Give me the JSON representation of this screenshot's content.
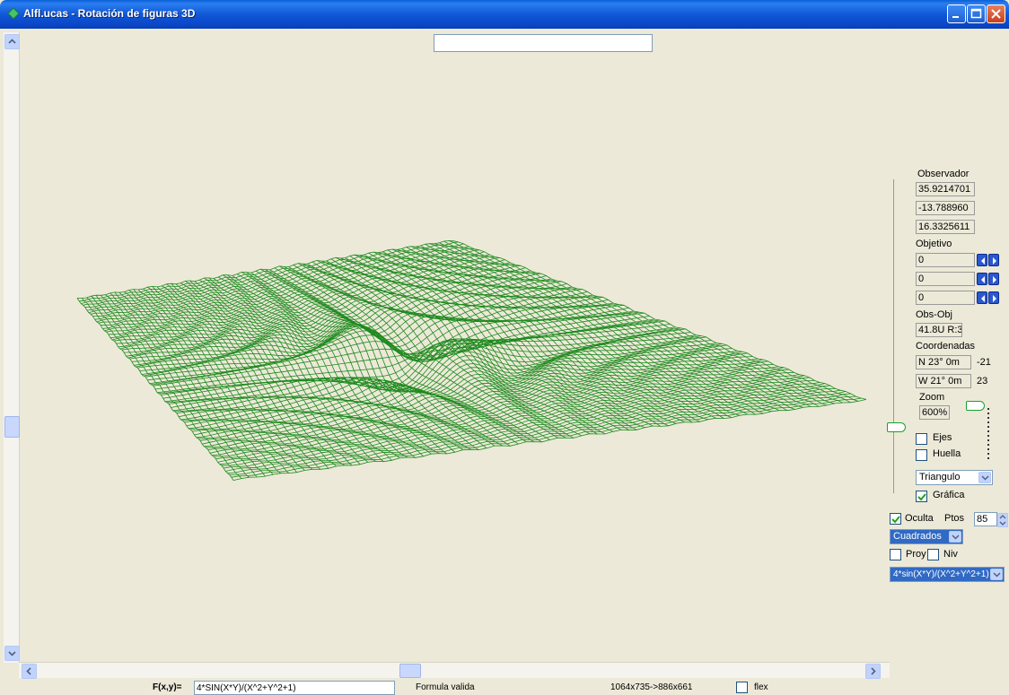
{
  "window": {
    "title": "Alfl.ucas - Rotación de figuras 3D"
  },
  "top_input": {
    "value": ""
  },
  "panel": {
    "observador_label": "Observador",
    "observador_values": [
      "35.9214701",
      "-13.788960",
      "16.3325611"
    ],
    "objetivo_label": "Objetivo",
    "objetivo_values": [
      "0",
      "0",
      "0"
    ],
    "obs_obj_label": "Obs-Obj",
    "obs_obj_value": "41.8U R:3",
    "coordenadas_label": "Coordenadas",
    "coord_n": "N 23° 0m",
    "coord_n_side": "-21",
    "coord_w": "W 21° 0m",
    "coord_w_side": "23",
    "zoom_label": "Zoom",
    "zoom_value": "600%",
    "ejes_label": "Ejes",
    "ejes_checked": false,
    "huella_label": "Huella",
    "huella_checked": false,
    "shape_select": "Triangulo",
    "grafica_label": "Gráfica",
    "grafica_checked": true,
    "oculta_label": "Oculta",
    "oculta_checked": true,
    "ptos_label": "Ptos",
    "ptos_value": "85",
    "mode_select": "Cuadrados",
    "proy_label": "Proy",
    "proy_checked": false,
    "niv_label": "Niv",
    "niv_checked": false,
    "formula_select": "4*sin(X*Y)/(X^2+Y^2+1)"
  },
  "status": {
    "fxy_label": "F(x,y)=",
    "formula_value": "4*SIN(X*Y)/(X^2+Y^2+1)",
    "validity": "Formula valida",
    "dimensions": "1064x735->886x661",
    "flex_label": "flex",
    "flex_checked": false
  },
  "colors": {
    "mesh": "#1f8a1f",
    "titlebar": "#0a5fd8"
  }
}
